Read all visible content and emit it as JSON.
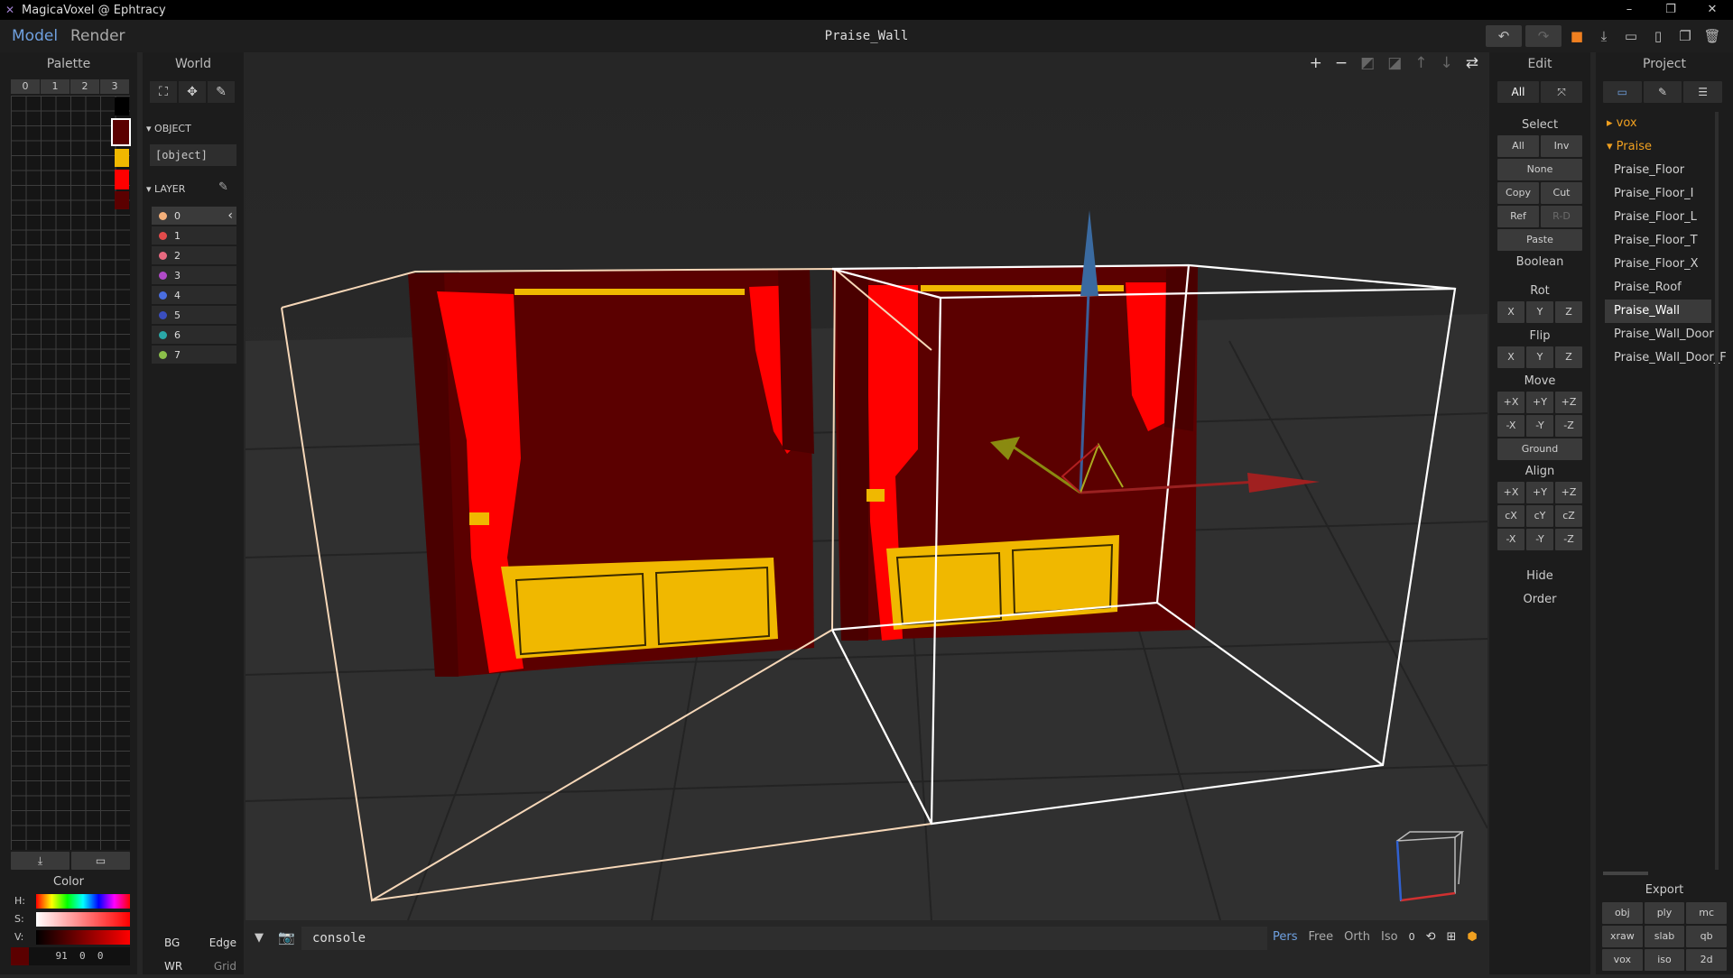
{
  "window": {
    "title": "MagicaVoxel @ Ephtracy",
    "minimize": "–",
    "restore": "❐",
    "close": "✕"
  },
  "modes": {
    "model": "Model",
    "render": "Render"
  },
  "file": {
    "name": "Praise_Wall"
  },
  "palette": {
    "title": "Palette",
    "tabs": [
      "0",
      "1",
      "2",
      "3"
    ],
    "swatches": [
      "#000000",
      "#5b0000",
      "#f0b800",
      "#ff0000",
      "#5b0000"
    ],
    "import_icon": "import-icon",
    "open_icon": "folder-icon"
  },
  "color": {
    "title": "Color",
    "h": "H:",
    "s": "S:",
    "v": "V:",
    "rgb": "91  0  0",
    "current": "#5b0000"
  },
  "world": {
    "title": "World",
    "object_section": "OBJECT",
    "object_value": "[object]",
    "layer_section": "LAYER",
    "layers": [
      {
        "id": "0",
        "color": "#f4b07a"
      },
      {
        "id": "1",
        "color": "#e24b4b"
      },
      {
        "id": "2",
        "color": "#e86a80"
      },
      {
        "id": "3",
        "color": "#b04ac8"
      },
      {
        "id": "4",
        "color": "#4a6ee0"
      },
      {
        "id": "5",
        "color": "#3a4ec0"
      },
      {
        "id": "6",
        "color": "#2aa8a8"
      },
      {
        "id": "7",
        "color": "#8cc04a"
      }
    ],
    "bottom": {
      "bg": "BG",
      "edge": "Edge",
      "wr": "WR",
      "grid": "Grid"
    }
  },
  "viewport": {
    "console": "console",
    "view_modes": [
      "Pers",
      "Free",
      "Orth",
      "Iso"
    ],
    "active_view": "Pers",
    "zoom_value": "0"
  },
  "edit": {
    "title": "Edit",
    "mode_all": "All",
    "select": "Select",
    "sel_all": "All",
    "sel_inv": "Inv",
    "sel_none": "None",
    "copy": "Copy",
    "cut": "Cut",
    "ref": "Ref",
    "rd": "R-D",
    "paste": "Paste",
    "boolean": "Boolean",
    "rot": "Rot",
    "flip": "Flip",
    "move": "Move",
    "align": "Align",
    "axes": [
      "X",
      "Y",
      "Z"
    ],
    "move_pos": [
      "+X",
      "+Y",
      "+Z"
    ],
    "move_neg": [
      "-X",
      "-Y",
      "-Z"
    ],
    "ground": "Ground",
    "align_pos": [
      "+X",
      "+Y",
      "+Z"
    ],
    "align_c": [
      "cX",
      "cY",
      "cZ"
    ],
    "align_neg": [
      "-X",
      "-Y",
      "-Z"
    ],
    "hide": "Hide",
    "order": "Order"
  },
  "project": {
    "title": "Project",
    "folders": [
      "vox",
      "Praise"
    ],
    "items": [
      "Praise_Floor",
      "Praise_Floor_I",
      "Praise_Floor_L",
      "Praise_Floor_T",
      "Praise_Floor_X",
      "Praise_Roof",
      "Praise_Wall",
      "Praise_Wall_Door",
      "Praise_Wall_Door_F"
    ],
    "selected": "Praise_Wall",
    "export": "Export",
    "export_formats": [
      "obj",
      "ply",
      "mc",
      "xraw",
      "slab",
      "qb",
      "vox",
      "iso",
      "2d"
    ]
  },
  "colors": {
    "accent": "#6fa0e0",
    "folder": "#f0a020",
    "curtain": "#ff0000",
    "wall": "#5b0000",
    "gold": "#f0b800"
  }
}
